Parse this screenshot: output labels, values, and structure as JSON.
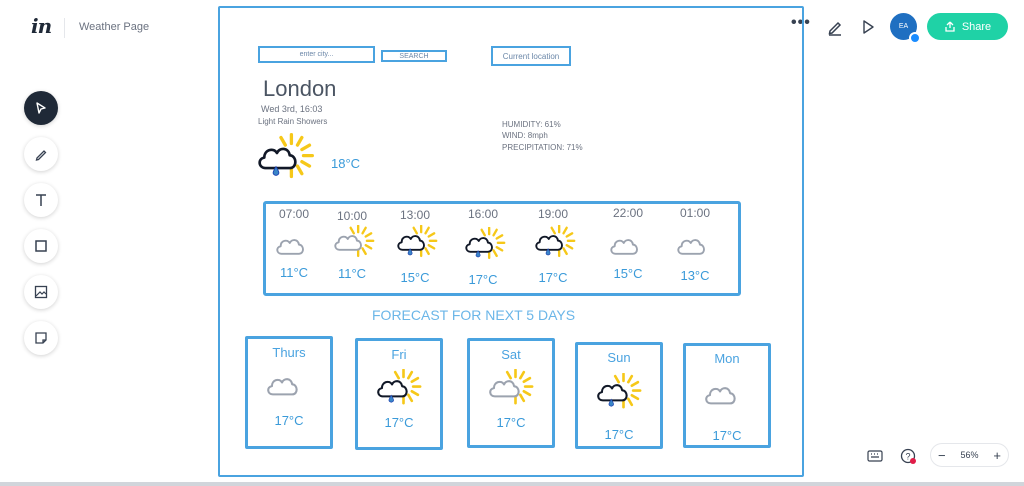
{
  "app": {
    "doc_title": "Weather Page",
    "share_label": "Share",
    "avatar_initials": "EA",
    "zoom": "56%",
    "brand_color": "#1fd2a6"
  },
  "search": {
    "placeholder": "enter city...",
    "button": "SEARCH",
    "location_button": "Current location"
  },
  "current": {
    "city": "London",
    "datetime": "Wed 3rd, 16:03",
    "condition": "Light Rain Showers",
    "temp": "18°C",
    "humidity": "HUMIDITY: 61%",
    "wind": "WIND: 8mph",
    "precipitation": "PRECIPITATION: 71%",
    "icon": "sun-rain-cloud-icon"
  },
  "hourly": [
    {
      "time": "07:00",
      "temp": "11°C",
      "icon": "cloud"
    },
    {
      "time": "10:00",
      "temp": "11°C",
      "icon": "sun-cloud"
    },
    {
      "time": "13:00",
      "temp": "15°C",
      "icon": "sun-rain"
    },
    {
      "time": "16:00",
      "temp": "17°C",
      "icon": "sun-rain"
    },
    {
      "time": "19:00",
      "temp": "17°C",
      "icon": "sun-rain"
    },
    {
      "time": "22:00",
      "temp": "15°C",
      "icon": "cloud"
    },
    {
      "time": "01:00",
      "temp": "13°C",
      "icon": "cloud"
    }
  ],
  "forecast_title": "FORECAST FOR NEXT 5 DAYS",
  "daily": [
    {
      "day": "Thurs",
      "temp": "17°C",
      "icon": "cloud"
    },
    {
      "day": "Fri",
      "temp": "17°C",
      "icon": "sun-rain"
    },
    {
      "day": "Sat",
      "temp": "17°C",
      "icon": "sun-cloud"
    },
    {
      "day": "Sun",
      "temp": "17°C",
      "icon": "sun-rain"
    },
    {
      "day": "Mon",
      "temp": "17°C",
      "icon": "cloud"
    }
  ]
}
